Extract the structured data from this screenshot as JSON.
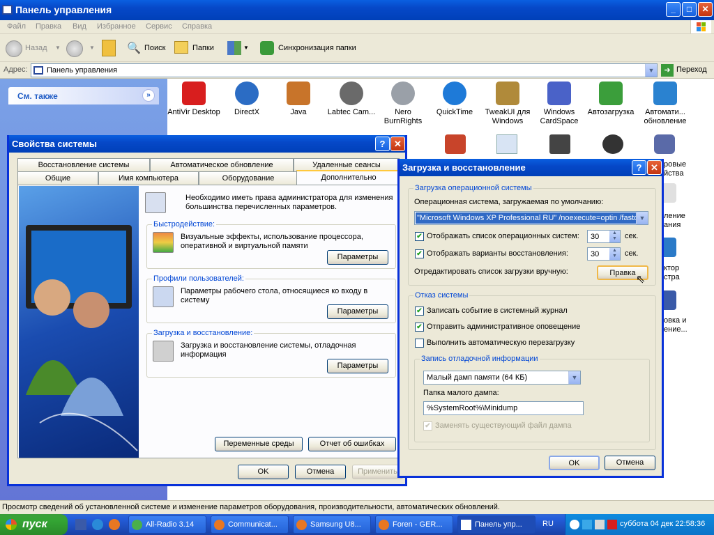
{
  "window": {
    "title": "Панель управления",
    "buttons": {
      "minimize": "_",
      "maximize": "□",
      "close": "✕"
    }
  },
  "menu": [
    "Файл",
    "Правка",
    "Вид",
    "Избранное",
    "Сервис",
    "Справка"
  ],
  "toolbar": {
    "back": "Назад",
    "search": "Поиск",
    "folders": "Папки",
    "sync": "Синхронизация папки"
  },
  "address": {
    "label": "Адрес:",
    "value": "Панель управления",
    "go": "Переход"
  },
  "sidebar": {
    "see_also": "См. также"
  },
  "control_panel_items": [
    {
      "label": "AntiVir Desktop",
      "color": "#d81e1e"
    },
    {
      "label": "DirectX",
      "color": "#2b6cc4"
    },
    {
      "label": "Java",
      "color": "#c8742a"
    },
    {
      "label": "Labtec Cam...",
      "color": "#6a6a6a"
    },
    {
      "label": "Nero BurnRights",
      "color": "#9aa0a8"
    },
    {
      "label": "QuickTime",
      "color": "#1e7ad8"
    },
    {
      "label": "TweakUI для Windows",
      "color": "#b08a3a"
    },
    {
      "label": "Windows CardSpace",
      "color": "#4a62c8"
    },
    {
      "label": "Автозагрузка",
      "color": "#3b9e3b"
    },
    {
      "label": "Автомати... обновление",
      "color": "#2a82d0"
    }
  ],
  "right_col_fragments": [
    "ровые",
    "йства",
    "ление",
    "ания",
    "ктор",
    "стра",
    "овка и",
    "ение..."
  ],
  "system_properties": {
    "title": "Свойства системы",
    "tabs_row1": [
      "Восстановление системы",
      "Автоматическое обновление",
      "Удаленные сеансы"
    ],
    "tabs_row2": [
      "Общие",
      "Имя компьютера",
      "Оборудование",
      "Дополнительно"
    ],
    "admin_note": "Необходимо иметь права администратора для изменения большинства перечисленных параметров.",
    "performance": {
      "legend": "Быстродействие:",
      "text": "Визуальные эффекты, использование процессора, оперативной и виртуальной памяти",
      "button": "Параметры"
    },
    "profiles": {
      "legend": "Профили пользователей:",
      "text": "Параметры рабочего стола, относящиеся ко входу в систему",
      "button": "Параметры"
    },
    "startup": {
      "legend": "Загрузка и восстановление:",
      "text": "Загрузка и восстановление системы, отладочная информация",
      "button": "Параметры"
    },
    "env_button": "Переменные среды",
    "error_button": "Отчет об ошибках",
    "ok": "OK",
    "cancel": "Отмена",
    "apply": "Применить"
  },
  "startup_recovery": {
    "title": "Загрузка и восстановление",
    "boot_group": "Загрузка операционной системы",
    "default_os_label": "Операционная система, загружаемая по умолчанию:",
    "default_os_value": "\"Microsoft Windows XP Professional RU\" /noexecute=optin /fastd",
    "show_os_list": "Отображать список операционных систем:",
    "show_os_seconds": "30",
    "show_recovery": "Отображать варианты восстановления:",
    "show_recovery_seconds": "30",
    "sec": "сек.",
    "edit_label": "Отредактировать список загрузки вручную:",
    "edit_button": "Правка",
    "failure_group": "Отказ системы",
    "write_event": "Записать событие в системный журнал",
    "send_alert": "Отправить административное оповещение",
    "auto_restart": "Выполнить автоматическую перезагрузку",
    "debug_group": "Запись отладочной информации",
    "dump_type": "Малый дамп памяти (64 КБ)",
    "dump_folder_label": "Папка малого дампа:",
    "dump_folder_value": "%SystemRoot%\\Minidump",
    "overwrite": "Заменять существующий файл дампа",
    "ok": "OK",
    "cancel": "Отмена",
    "checks": {
      "show_os": true,
      "show_recovery": true,
      "write_event": true,
      "send_alert": true,
      "auto_restart": false,
      "overwrite": true
    }
  },
  "status": "Просмотр сведений об установленной системе и изменение параметров оборудования, производительности, автоматических обновлений.",
  "taskbar": {
    "start": "пуск",
    "tasks": [
      "All-Radio 3.14",
      "Communicat...",
      "Samsung U8...",
      "Foren - GER...",
      "Панель упр..."
    ],
    "lang": "RU",
    "clock": "суббота 04 дек 22:58:36"
  }
}
